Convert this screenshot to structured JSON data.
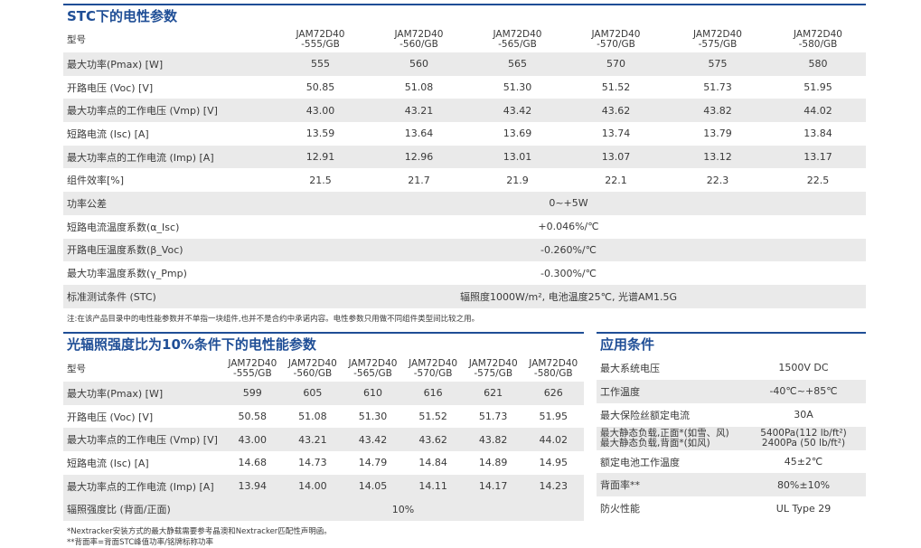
{
  "stc": {
    "title": "STC下的电性参数",
    "header_label": "型号",
    "models": [
      "JAM72D40\n-555/GB",
      "JAM72D40\n-560/GB",
      "JAM72D40\n-565/GB",
      "JAM72D40\n-570/GB",
      "JAM72D40\n-575/GB",
      "JAM72D40\n-580/GB"
    ],
    "rows": [
      {
        "label": "最大功率(Pmax) [W]",
        "values": [
          "555",
          "560",
          "565",
          "570",
          "575",
          "580"
        ]
      },
      {
        "label": "开路电压 (Voc) [V]",
        "values": [
          "50.85",
          "51.08",
          "51.30",
          "51.52",
          "51.73",
          "51.95"
        ]
      },
      {
        "label": "最大功率点的工作电压 (Vmp) [V]",
        "values": [
          "43.00",
          "43.21",
          "43.42",
          "43.62",
          "43.82",
          "44.02"
        ]
      },
      {
        "label": "短路电流 (Isc) [A]",
        "values": [
          "13.59",
          "13.64",
          "13.69",
          "13.74",
          "13.79",
          "13.84"
        ]
      },
      {
        "label": "最大功率点的工作电流 (Imp) [A]",
        "values": [
          "12.91",
          "12.96",
          "13.01",
          "13.07",
          "13.12",
          "13.17"
        ]
      },
      {
        "label": "组件效率[%]",
        "values": [
          "21.5",
          "21.7",
          "21.9",
          "22.1",
          "22.3",
          "22.5"
        ]
      }
    ],
    "span_rows": [
      {
        "label": "功率公差",
        "value": "0~+5W"
      },
      {
        "label": "短路电流温度系数(α_Isc)",
        "value": "+0.046%/℃"
      },
      {
        "label": "开路电压温度系数(β_Voc)",
        "value": "-0.260%/℃"
      },
      {
        "label": "最大功率温度系数(γ_Pmp)",
        "value": "-0.300%/℃"
      },
      {
        "label": "标准测试条件 (STC)",
        "value": "辐照度1000W/m², 电池温度25℃, 光谱AM1.5G"
      }
    ],
    "note": "注:在该产品目录中的电性能参数并不单指一块组件,也并不是合约中承诺内容。电性参数只用做不同组件类型间比较之用。"
  },
  "low_irr": {
    "title": "光辐照强度比为10%条件下的电性能参数",
    "header_label": "型号",
    "models": [
      "JAM72D40\n-555/GB",
      "JAM72D40\n-560/GB",
      "JAM72D40\n-565/GB",
      "JAM72D40\n-570/GB",
      "JAM72D40\n-575/GB",
      "JAM72D40\n-580/GB"
    ],
    "rows": [
      {
        "label": "最大功率(Pmax) [W]",
        "values": [
          "599",
          "605",
          "610",
          "616",
          "621",
          "626"
        ]
      },
      {
        "label": "开路电压 (Voc) [V]",
        "values": [
          "50.58",
          "51.08",
          "51.30",
          "51.52",
          "51.73",
          "51.95"
        ]
      },
      {
        "label": "最大功率点的工作电压 (Vmp) [V]",
        "values": [
          "43.00",
          "43.21",
          "43.42",
          "43.62",
          "43.82",
          "44.02"
        ]
      },
      {
        "label": "短路电流 (Isc) [A]",
        "values": [
          "14.68",
          "14.73",
          "14.79",
          "14.84",
          "14.89",
          "14.95"
        ]
      },
      {
        "label": "最大功率点的工作电流 (Imp) [A]",
        "values": [
          "13.94",
          "14.00",
          "14.05",
          "14.11",
          "14.17",
          "14.23"
        ]
      }
    ],
    "ratio_row": {
      "label": "辐照强度比 (背面/正面)",
      "value": "10%"
    },
    "notes": [
      "*Nextracker安装方式的最大静载需要参考晶澳和Nextracker匹配性声明函。",
      "**背面率=背面STC峰值功率/铭牌标称功率"
    ]
  },
  "app": {
    "title": "应用条件",
    "rows": [
      {
        "label": "最大系统电压",
        "value": "1500V DC"
      },
      {
        "label": "工作温度",
        "value": "-40℃~+85℃"
      },
      {
        "label": "最大保险丝额定电流",
        "value": "30A"
      },
      {
        "label": "最大静态负载,正面*(如雪、风)\n最大静态负载,背面*(如风)",
        "value": "5400Pa(112 lb/ft²)\n2400Pa (50 lb/ft²)"
      },
      {
        "label": "额定电池工作温度",
        "value": "45±2℃"
      },
      {
        "label": "背面率**",
        "value": "80%±10%"
      },
      {
        "label": "防火性能",
        "value": "UL Type 29"
      }
    ]
  }
}
